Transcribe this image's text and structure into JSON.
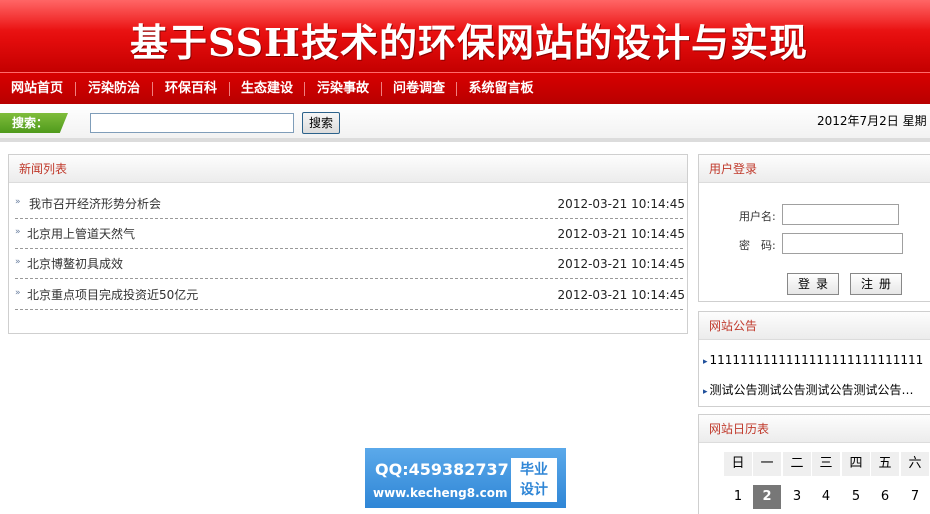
{
  "banner": {
    "title": "基于SSH技术的环保网站的设计与实现"
  },
  "nav": {
    "items": [
      "网站首页",
      "污染防治",
      "环保百科",
      "生态建设",
      "污染事故",
      "问卷调查",
      "系统留言板"
    ]
  },
  "search": {
    "label": "搜索：",
    "input_value": "",
    "button": "搜索",
    "date": "2012年7月2日 星期"
  },
  "news": {
    "title": "新闻列表",
    "rows": [
      {
        "title": "我市召开经济形势分析会",
        "time": "2012-03-21 10:14:45"
      },
      {
        "title": "北京用上管道天然气",
        "time": "2012-03-21 10:14:45"
      },
      {
        "title": "北京博鳌初具成效",
        "time": "2012-03-21 10:14:45"
      },
      {
        "title": "北京重点项目完成投资近50亿元",
        "time": "2012-03-21 10:14:45"
      }
    ]
  },
  "login": {
    "title": "用户登录",
    "username_label": "用户名:",
    "password_label": "密　码:",
    "username_value": "",
    "password_value": "",
    "login_button": "登录",
    "register_button": "注册"
  },
  "notice": {
    "title": "网站公告",
    "items": [
      "1111111111111111111111111111",
      "测试公告测试公告测试公告测试公告…"
    ]
  },
  "calendar": {
    "title": "网站日历表",
    "weekdays": [
      "日",
      "一",
      "二",
      "三",
      "四",
      "五",
      "六"
    ],
    "days": [
      "1",
      "2",
      "3",
      "4",
      "5",
      "6",
      "7"
    ],
    "today": "2"
  },
  "watermark": {
    "qq": "QQ:459382737",
    "site": "www.kecheng8.com",
    "badge_line1": "毕业",
    "badge_line2": "设计"
  },
  "colors": {
    "banner_red": "#e30c0c",
    "nav_red": "#c80000",
    "heading_red": "#c0392b",
    "search_green": "#5fa82a"
  }
}
